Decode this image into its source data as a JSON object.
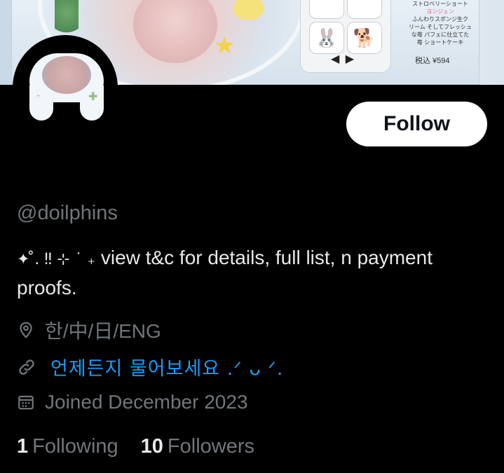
{
  "banner": {
    "text_lines": [
      "ストロベリーショート",
      "ヨンジュン",
      "ふんわりスポンジ生ク",
      "リーム そしてフレッシュ",
      "な苺 パフェに仕立てた",
      "苺 ショートケーキ"
    ],
    "price": "税込 ¥594",
    "tile_emojis": [
      "🐰",
      "🐕"
    ],
    "arrows": "◀ ▶"
  },
  "profile": {
    "follow_label": "Follow",
    "handle": "@doilphins",
    "bio_decoration": "✦ ̊. ‼ ⊹ ˙ ₊",
    "bio_text": " view t&c for details, full list, n payment proofs.",
    "location": "한/中/日/ENG",
    "link": "언제든지  물어보세요 .ᐟ ᴗ ᐟ.",
    "joined": "Joined December 2023",
    "following_count": "1",
    "following_label": "Following",
    "followers_count": "10",
    "followers_label": "Followers"
  },
  "icons": {
    "location": "location-pin-icon",
    "link": "link-icon",
    "joined": "calendar-icon"
  },
  "colors": {
    "background": "#000000",
    "text_primary": "#e7e9ea",
    "text_secondary": "#71767b",
    "link": "#1d9bf0",
    "button_bg": "#ffffff",
    "button_text": "#0f1419"
  }
}
